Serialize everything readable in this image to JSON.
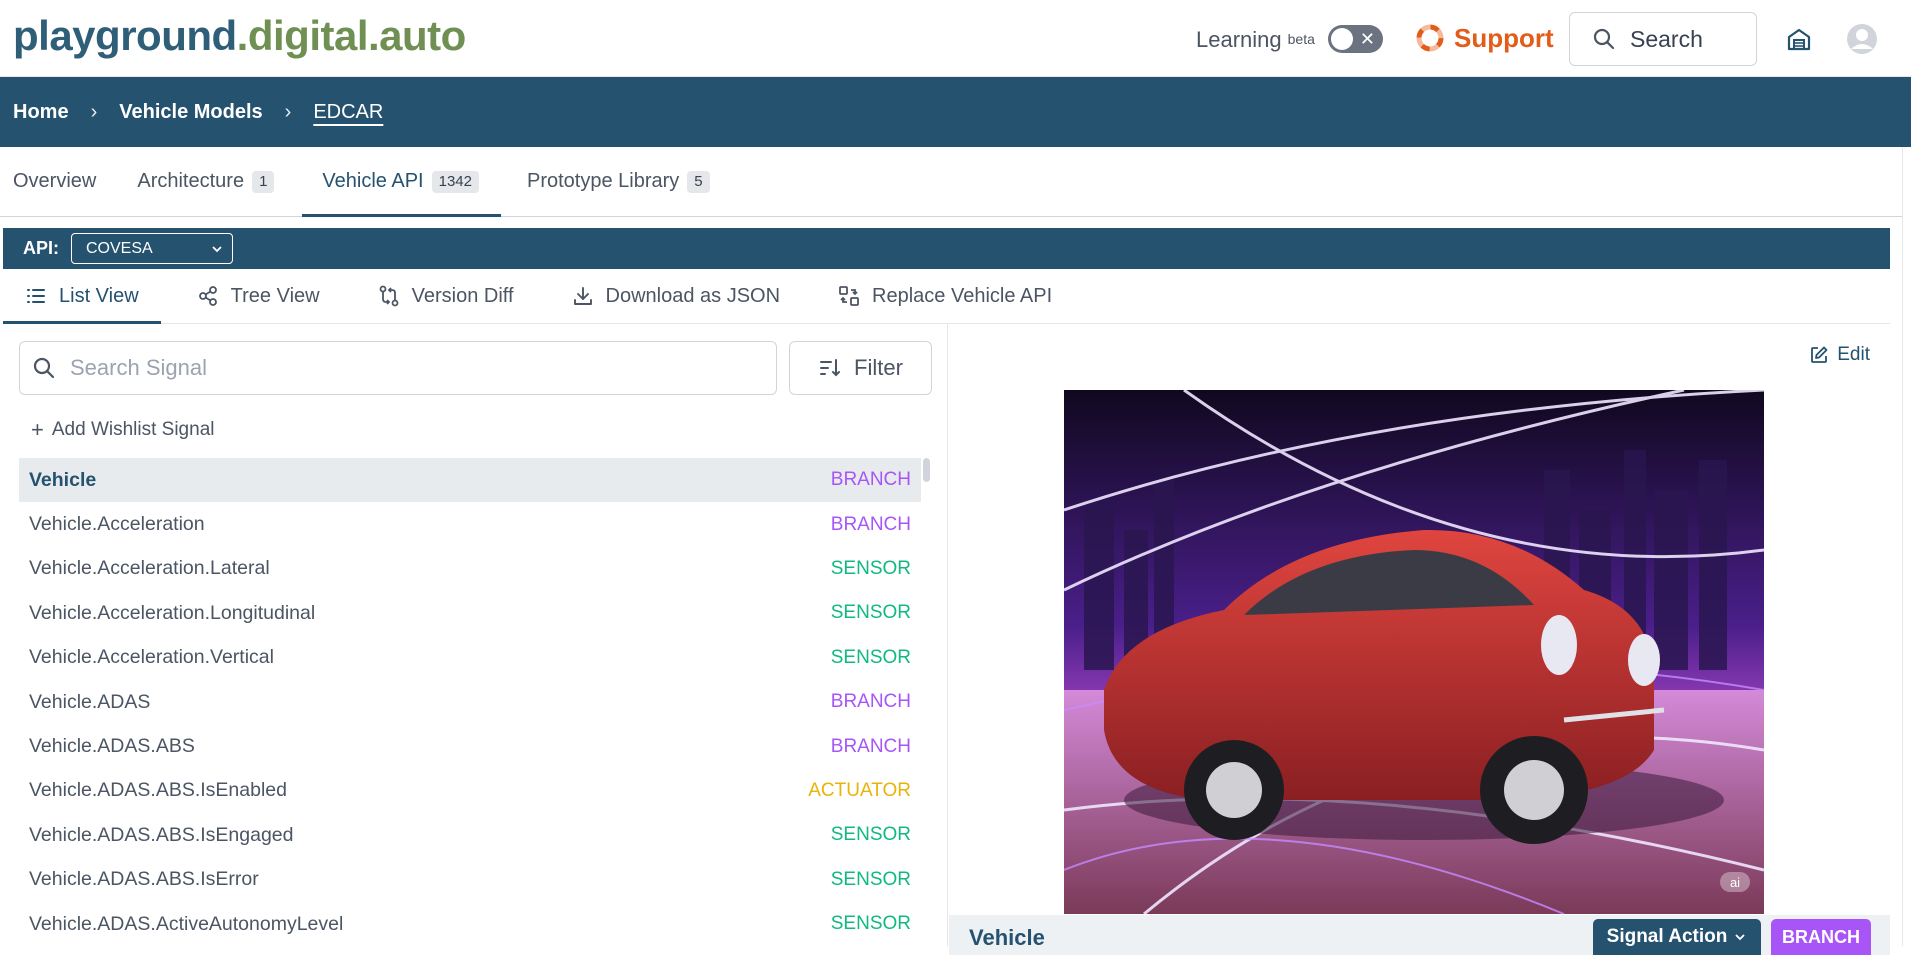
{
  "header": {
    "logo_part1": "playground",
    "logo_part2": ".digital.auto",
    "learning_label": "Learning",
    "beta_label": "beta",
    "support_label": "Support",
    "search_label": "Search"
  },
  "breadcrumb": {
    "items": [
      "Home",
      "Vehicle Models",
      "EDCAR"
    ]
  },
  "tabs": [
    {
      "label": "Overview",
      "badge": ""
    },
    {
      "label": "Architecture",
      "badge": "1"
    },
    {
      "label": "Vehicle API",
      "badge": "1342"
    },
    {
      "label": "Prototype Library",
      "badge": "5"
    }
  ],
  "api_bar": {
    "label": "API:",
    "selected": "COVESA"
  },
  "subtabs": [
    {
      "label": "List View"
    },
    {
      "label": "Tree View"
    },
    {
      "label": "Version Diff"
    },
    {
      "label": "Download as JSON"
    },
    {
      "label": "Replace Vehicle API"
    }
  ],
  "left": {
    "search_placeholder": "Search Signal",
    "filter_label": "Filter",
    "wishlist_label": "Add Wishlist Signal"
  },
  "signals": [
    {
      "name": "Vehicle",
      "type": "BRANCH"
    },
    {
      "name": "Vehicle.Acceleration",
      "type": "BRANCH"
    },
    {
      "name": "Vehicle.Acceleration.Lateral",
      "type": "SENSOR"
    },
    {
      "name": "Vehicle.Acceleration.Longitudinal",
      "type": "SENSOR"
    },
    {
      "name": "Vehicle.Acceleration.Vertical",
      "type": "SENSOR"
    },
    {
      "name": "Vehicle.ADAS",
      "type": "BRANCH"
    },
    {
      "name": "Vehicle.ADAS.ABS",
      "type": "BRANCH"
    },
    {
      "name": "Vehicle.ADAS.ABS.IsEnabled",
      "type": "ACTUATOR"
    },
    {
      "name": "Vehicle.ADAS.ABS.IsEngaged",
      "type": "SENSOR"
    },
    {
      "name": "Vehicle.ADAS.ABS.IsError",
      "type": "SENSOR"
    },
    {
      "name": "Vehicle.ADAS.ActiveAutonomyLevel",
      "type": "SENSOR"
    }
  ],
  "type_colors": {
    "BRANCH": "#a855f7",
    "SENSOR": "#10b981",
    "ACTUATOR": "#eab308"
  },
  "right": {
    "edit_label": "Edit",
    "ai_tag": "ai",
    "detail_name": "Vehicle",
    "signal_action_label": "Signal Action",
    "detail_type": "BRANCH"
  },
  "colors": {
    "primary": "#24526f",
    "support": "#e25d1a"
  }
}
